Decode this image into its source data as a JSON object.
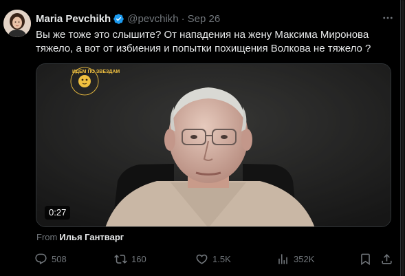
{
  "author": {
    "display_name": "Maria Pevchikh",
    "handle": "@pevchikh",
    "separator": "·",
    "date": "Sep 26",
    "verified": true
  },
  "tweet": {
    "text": "Вы же тоже это слышите? От нападения на жену Максима Миронова тяжело, а вот от избиения и попытки похищения Волкова не тяжело ?"
  },
  "media": {
    "duration": "0:27",
    "watermark_text": "ИДЕМ ПО ЗВЕЗДАМ",
    "source_prefix": "From",
    "source_name": "Илья Гантварг"
  },
  "actions": {
    "replies": "508",
    "reposts": "160",
    "likes": "1.5K",
    "views": "352K"
  },
  "colors": {
    "background": "#000000",
    "text_primary": "#e7e9ea",
    "text_secondary": "#71767b",
    "verified_blue": "#1d9bf0",
    "border": "#2f3336"
  },
  "icons": [
    "verified-badge-icon",
    "more-icon",
    "reply-icon",
    "repost-icon",
    "like-icon",
    "views-icon",
    "bookmark-icon",
    "share-icon"
  ]
}
